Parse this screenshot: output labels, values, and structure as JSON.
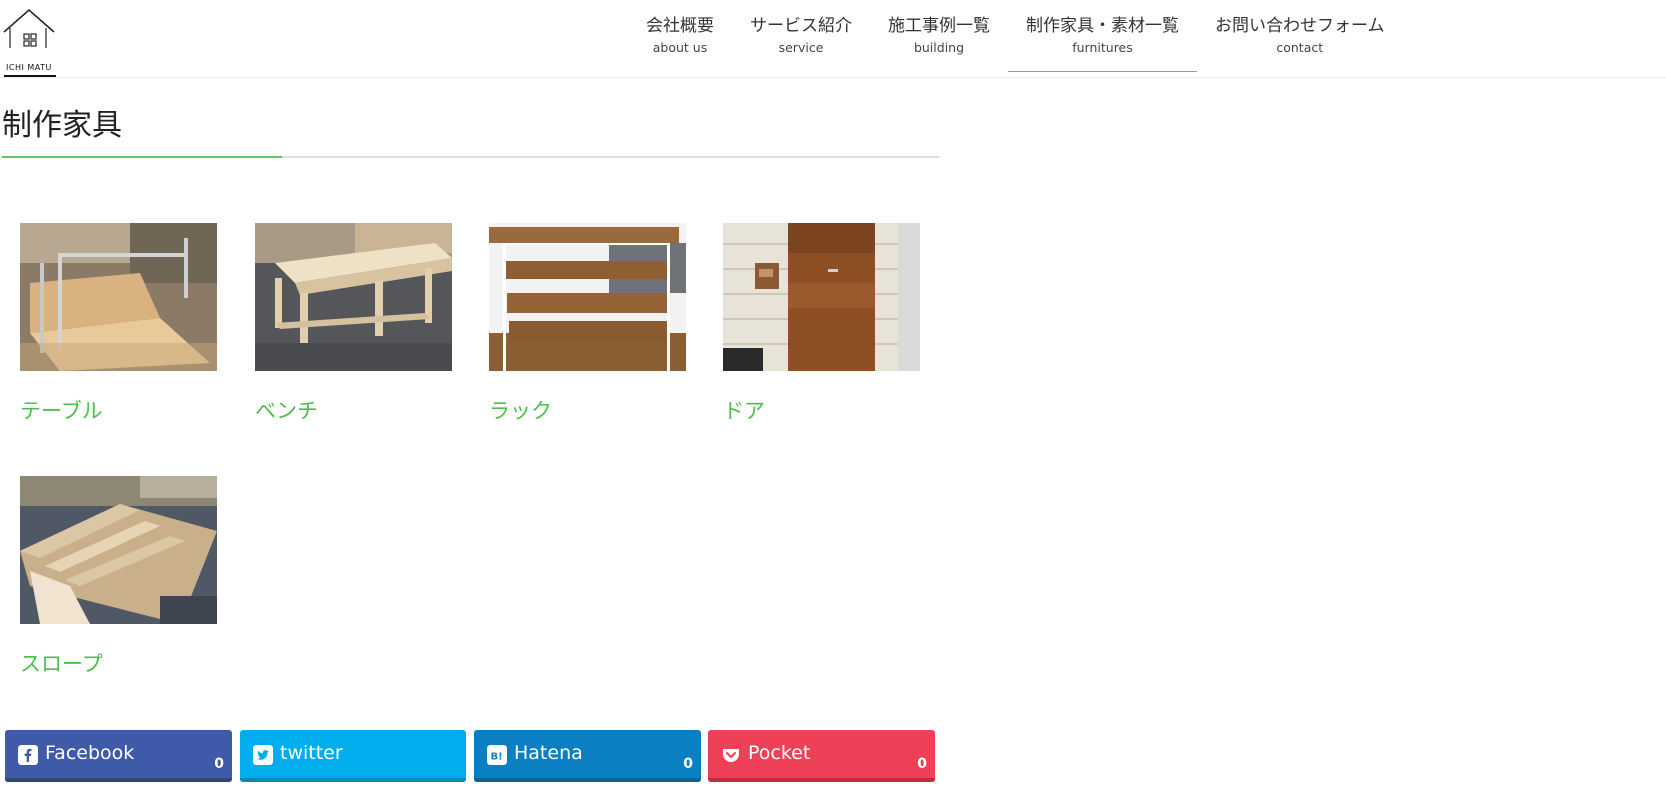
{
  "logo": {
    "text": "ICHI MATU"
  },
  "nav": [
    {
      "ja": "会社概要",
      "en": "about us"
    },
    {
      "ja": "サービス紹介",
      "en": "service"
    },
    {
      "ja": "施工事例一覧",
      "en": "building"
    },
    {
      "ja": "制作家具・素材一覧",
      "en": "furnitures"
    },
    {
      "ja": "お問い合わせフォーム",
      "en": "contact"
    }
  ],
  "nav_active_index": 3,
  "page": {
    "title": "制作家具"
  },
  "items": [
    {
      "label": "テーブル"
    },
    {
      "label": "ベンチ"
    },
    {
      "label": "ラック"
    },
    {
      "label": "ドア"
    },
    {
      "label": "スロープ"
    }
  ],
  "share": {
    "facebook": {
      "label": "Facebook",
      "count": "0"
    },
    "twitter": {
      "label": "twitter"
    },
    "hatena": {
      "label": "Hatena",
      "count": "0"
    },
    "pocket": {
      "label": "Pocket",
      "count": "0"
    }
  },
  "colors": {
    "accent": "#5cc85c",
    "item_label": "#4cbf4c",
    "facebook": "#3f5aa8",
    "twitter": "#00aded",
    "hatena": "#0a7fc1",
    "pocket": "#ee4056"
  }
}
